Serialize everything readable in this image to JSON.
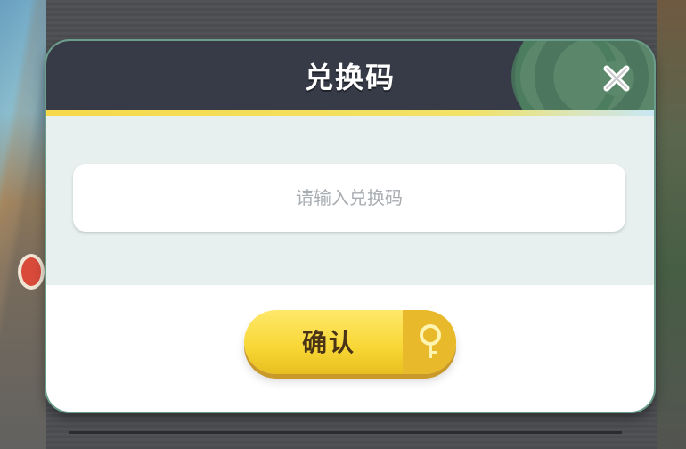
{
  "dialog": {
    "title": "兑换码",
    "close_icon": "close-icon"
  },
  "redeem": {
    "placeholder": "请输入兑换码"
  },
  "confirm": {
    "label": "确认",
    "icon": "key-icon"
  },
  "colors": {
    "header_bg": "#363b47",
    "accent_yellow": "#f7d634",
    "body_bg": "#e8f0ef"
  }
}
